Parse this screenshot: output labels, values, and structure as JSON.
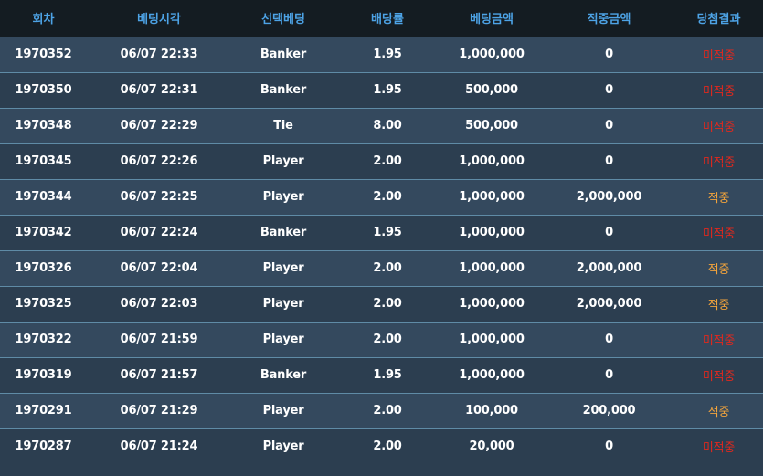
{
  "table": {
    "headers": [
      "회차",
      "베팅시각",
      "선택베팅",
      "배당률",
      "베팅금액",
      "적중금액",
      "당첨결과"
    ],
    "rows": [
      {
        "round": "1970352",
        "time": "06/07 22:33",
        "pick": "Banker",
        "odds": "1.95",
        "bet_amount": "1,000,000",
        "win_amount": "0",
        "result": "미적중",
        "result_type": "miss"
      },
      {
        "round": "1970350",
        "time": "06/07 22:31",
        "pick": "Banker",
        "odds": "1.95",
        "bet_amount": "500,000",
        "win_amount": "0",
        "result": "미적중",
        "result_type": "miss"
      },
      {
        "round": "1970348",
        "time": "06/07 22:29",
        "pick": "Tie",
        "odds": "8.00",
        "bet_amount": "500,000",
        "win_amount": "0",
        "result": "미적중",
        "result_type": "miss"
      },
      {
        "round": "1970345",
        "time": "06/07 22:26",
        "pick": "Player",
        "odds": "2.00",
        "bet_amount": "1,000,000",
        "win_amount": "0",
        "result": "미적중",
        "result_type": "miss"
      },
      {
        "round": "1970344",
        "time": "06/07 22:25",
        "pick": "Player",
        "odds": "2.00",
        "bet_amount": "1,000,000",
        "win_amount": "2,000,000",
        "result": "적중",
        "result_type": "hit"
      },
      {
        "round": "1970342",
        "time": "06/07 22:24",
        "pick": "Banker",
        "odds": "1.95",
        "bet_amount": "1,000,000",
        "win_amount": "0",
        "result": "미적중",
        "result_type": "miss"
      },
      {
        "round": "1970326",
        "time": "06/07 22:04",
        "pick": "Player",
        "odds": "2.00",
        "bet_amount": "1,000,000",
        "win_amount": "2,000,000",
        "result": "적중",
        "result_type": "hit"
      },
      {
        "round": "1970325",
        "time": "06/07 22:03",
        "pick": "Player",
        "odds": "2.00",
        "bet_amount": "1,000,000",
        "win_amount": "2,000,000",
        "result": "적중",
        "result_type": "hit"
      },
      {
        "round": "1970322",
        "time": "06/07 21:59",
        "pick": "Player",
        "odds": "2.00",
        "bet_amount": "1,000,000",
        "win_amount": "0",
        "result": "미적중",
        "result_type": "miss"
      },
      {
        "round": "1970319",
        "time": "06/07 21:57",
        "pick": "Banker",
        "odds": "1.95",
        "bet_amount": "1,000,000",
        "win_amount": "0",
        "result": "미적중",
        "result_type": "miss"
      },
      {
        "round": "1970291",
        "time": "06/07 21:29",
        "pick": "Player",
        "odds": "2.00",
        "bet_amount": "100,000",
        "win_amount": "200,000",
        "result": "적중",
        "result_type": "hit"
      },
      {
        "round": "1970287",
        "time": "06/07 21:24",
        "pick": "Player",
        "odds": "2.00",
        "bet_amount": "20,000",
        "win_amount": "0",
        "result": "미적중",
        "result_type": "miss"
      }
    ]
  },
  "colors": {
    "header_bg": "#141c22",
    "header_text": "#4da3e6",
    "row_bg_a": "#34495e",
    "row_bg_b": "#2c3e50",
    "row_divider": "#5f8ba6",
    "cell_text": "#ffffff",
    "result_miss": "#e2281d",
    "result_hit": "#f1a33c"
  }
}
